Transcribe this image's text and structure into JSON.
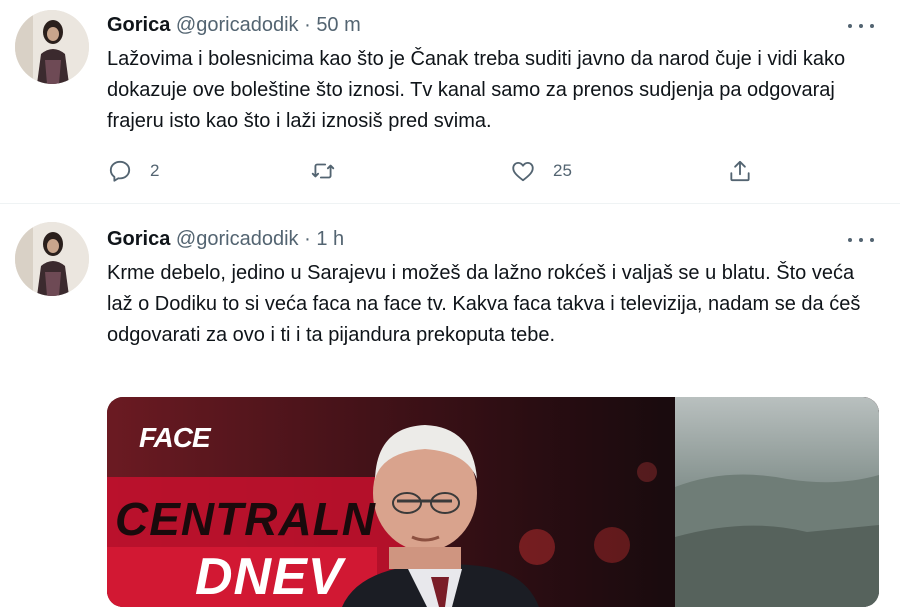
{
  "tweets": [
    {
      "name": "Gorica",
      "handle": "@goricadodik",
      "separator": "·",
      "time": "50 m",
      "text": "Lažovima i bolesnicima kao što je Čanak treba suditi javno da narod čuje i vidi kako dokazuje ove boleštine što iznosi. Tv kanal samo za prenos sudjenja pa odgovaraj frajeru isto kao što i laži iznosiš pred svima.",
      "replies": "2",
      "retweets": "",
      "likes": "25"
    },
    {
      "name": "Gorica",
      "handle": "@goricadodik",
      "separator": "·",
      "time": "1 h",
      "text": "Krme debelo, jedino u Sarajevu i možeš da lažno rokćeš i valjaš se u blatu. Što veća laž o Dodiku to si veća faca na face tv. Kakva faca takva i televizija, nadam se da ćeš odgovarati za ovo i ti i ta pijandura prekoputa tebe.",
      "media": {
        "logo": "FACE",
        "banner_line1": "CENTRALN",
        "banner_line2": "DNEV"
      }
    }
  ],
  "icons": {
    "reply": "reply-icon",
    "retweet": "retweet-icon",
    "like": "heart-icon",
    "share": "share-icon",
    "more": "more-icon"
  },
  "colors": {
    "text": "#0f1419",
    "secondary": "#536471",
    "divider": "#eff3f4",
    "banner_red": "#b8142a"
  }
}
